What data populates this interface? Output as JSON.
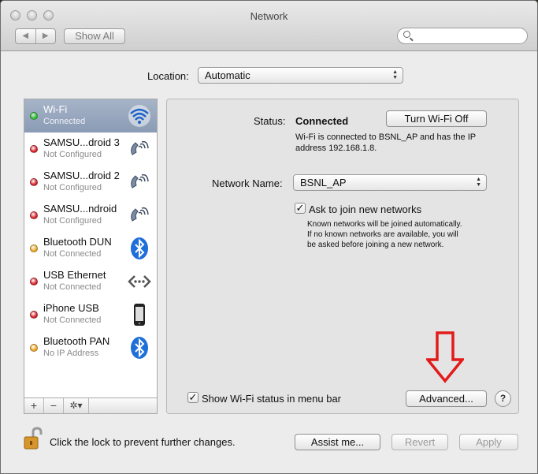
{
  "window": {
    "title": "Network"
  },
  "toolbar": {
    "back_label": "◀",
    "forward_label": "▶",
    "show_all_label": "Show All",
    "search_placeholder": ""
  },
  "location": {
    "label": "Location:",
    "value": "Automatic"
  },
  "services": [
    {
      "name": "Wi-Fi",
      "status": "Connected",
      "dot_color": "#2fc42f",
      "icon": "wifi-icon",
      "selected": true
    },
    {
      "name": "SAMSU...droid 3",
      "status": "Not Configured",
      "dot_color": "#d9232a",
      "icon": "modem-phone-icon"
    },
    {
      "name": "SAMSU...droid 2",
      "status": "Not Configured",
      "dot_color": "#d9232a",
      "icon": "modem-phone-icon"
    },
    {
      "name": "SAMSU...ndroid",
      "status": "Not Configured",
      "dot_color": "#d9232a",
      "icon": "modem-phone-icon"
    },
    {
      "name": "Bluetooth DUN",
      "status": "Not Connected",
      "dot_color": "#f0a724",
      "icon": "bluetooth-icon"
    },
    {
      "name": "USB Ethernet",
      "status": "Not Connected",
      "dot_color": "#d9232a",
      "icon": "ethernet-icon"
    },
    {
      "name": "iPhone USB",
      "status": "Not Connected",
      "dot_color": "#d9232a",
      "icon": "iphone-icon"
    },
    {
      "name": "Bluetooth PAN",
      "status": "No IP Address",
      "dot_color": "#f0a724",
      "icon": "bluetooth-icon"
    }
  ],
  "sidebar_toolbar": {
    "add": "+",
    "remove": "−",
    "gear": "✲▾"
  },
  "detail": {
    "status_label": "Status:",
    "status_value": "Connected",
    "turn_off_label": "Turn Wi-Fi Off",
    "status_desc_line1": "Wi-Fi is connected to BSNL_AP and has the IP",
    "status_desc_line2": "address 192.168.1.8.",
    "network_name_label": "Network Name:",
    "network_name_value": "BSNL_AP",
    "ask_join_label": "Ask to join new networks",
    "ask_join_checked": true,
    "ask_join_desc_line1": "Known networks will be joined automatically.",
    "ask_join_desc_line2": "If no known networks are available, you will",
    "ask_join_desc_line3": "be asked before joining a new network.",
    "show_status_label": "Show Wi-Fi status in menu bar",
    "show_status_checked": true,
    "advanced_label": "Advanced...",
    "help_label": "?"
  },
  "footer": {
    "lock_text": "Click the lock to prevent further changes.",
    "assist_label": "Assist me...",
    "revert_label": "Revert",
    "apply_label": "Apply"
  },
  "colors": {
    "annotation_arrow": "#e21b1b",
    "selected_row": "#8a9bb5"
  }
}
